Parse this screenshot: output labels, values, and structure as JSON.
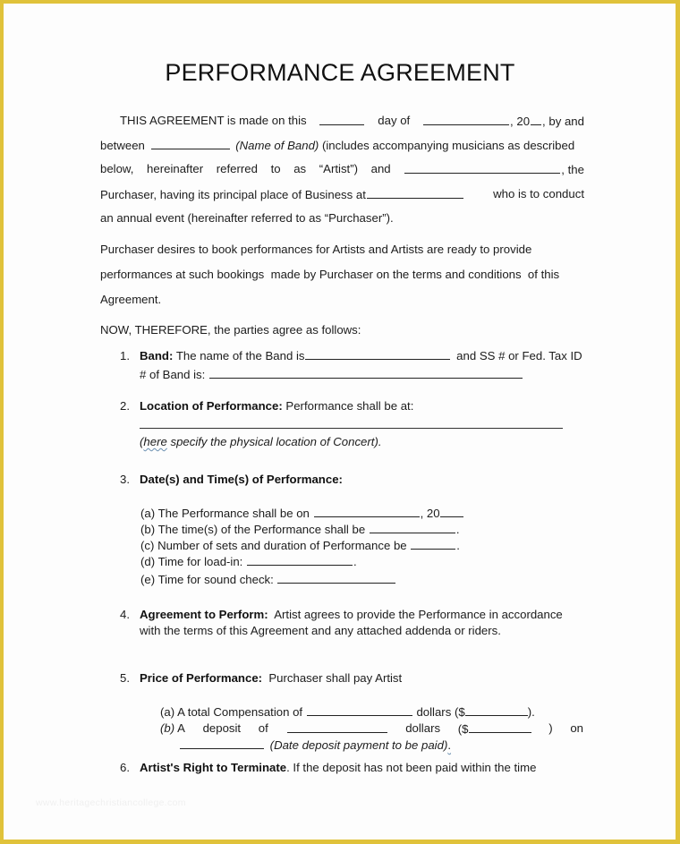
{
  "document": {
    "title": "PERFORMANCE AGREEMENT",
    "border_color": "#E0C23A",
    "intro": {
      "l1_a": "THIS AGREEMENT is made on this",
      "l1_b": "day of",
      "l1_c": ", 20",
      "l1_d": ", by and",
      "l2_a": "between",
      "l2_b": "(Name of Band)",
      "l2_c": "(includes accompanying musicians as described",
      "l3_words": [
        "below,",
        "hereinafter",
        "referred",
        "to",
        "as",
        "“Artist”)",
        "and"
      ],
      "l3_end": ", the",
      "l4_a": "Purchaser, having its principal place of Business at",
      "l4_b": "who is to conduct",
      "l5": "an annual event (hereinafter referred to as “Purchaser”)."
    },
    "para2": {
      "l1": "Purchaser desires to book performances for Artists and Artists are ready to provide",
      "l2": "performances at such bookings  made by Purchaser on the terms and conditions  of this",
      "l3": "Agreement."
    },
    "now_therefore": "NOW, THEREFORE, the parties agree as follows:",
    "clauses": {
      "c1": {
        "num": "1.",
        "heading": "Band:",
        "text_a": "The name of the Band is",
        "text_b": "and SS # or Fed. Tax ID",
        "text_c": "# of Band is:"
      },
      "c2": {
        "num": "2.",
        "heading": "Location of Performance:",
        "text": "Performance shall be at:",
        "note_a": "here",
        "note_b": " specify the physical location of Concert)."
      },
      "c3": {
        "num": "3.",
        "heading": "Date(s) and Time(s) of Performance:",
        "items": [
          {
            "label": "(a)",
            "text": "The Performance shall be on",
            "suffix": ", 20"
          },
          {
            "label": "(b)",
            "text": "The time(s) of the Performance shall be",
            "suffix": "."
          },
          {
            "label": "(c)",
            "text": "Number of sets and duration of Performance be",
            "suffix": "."
          },
          {
            "label": "(d)",
            "text": "Time for load-in:",
            "suffix": "."
          },
          {
            "label": "(e)",
            "text": "Time for sound check:",
            "suffix": ""
          }
        ]
      },
      "c4": {
        "num": "4.",
        "heading": "Agreement to Perform:",
        "text_l1": "Artist agrees to provide the Performance in accordance",
        "text_l2": "with the terms of this Agreement and any attached addenda or riders."
      },
      "c5": {
        "num": "5.",
        "heading": "Price of Performance:",
        "text": "Purchaser shall pay Artist",
        "a_label": "(a)",
        "a_text1": "A total Compensation of",
        "a_text2": "dollars ($",
        "a_text3": ").",
        "b_label": "(b)",
        "b_words": [
          "A",
          "deposit",
          "of"
        ],
        "b_text2": "dollars",
        "b_text3": "($",
        "b_text4": ")",
        "b_text5": "on",
        "b_note": "(Date deposit payment to be paid)",
        "b_end": "."
      },
      "c6": {
        "num": "6.",
        "heading": "Artist's Right to Terminate",
        "text": ". If the deposit has not been paid within the time"
      }
    },
    "watermark": "www.heritagechristiancollege.com"
  }
}
